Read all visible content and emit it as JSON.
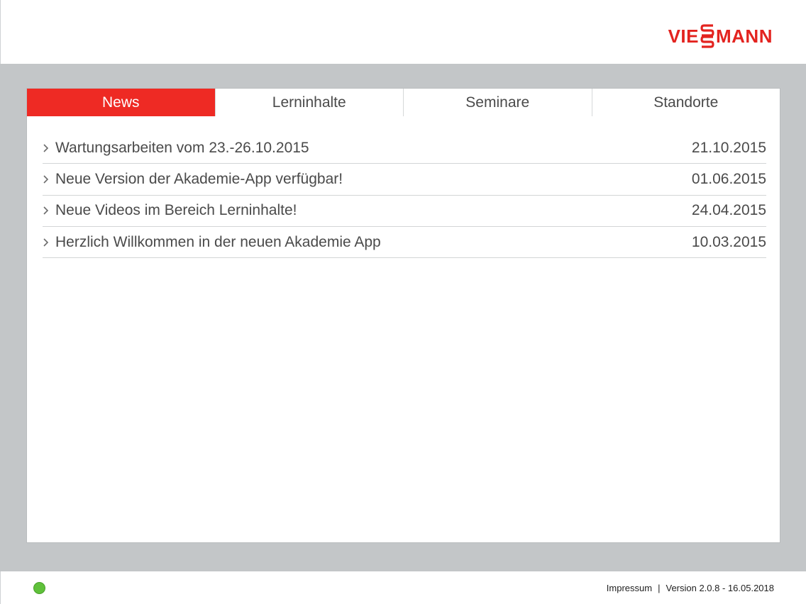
{
  "brand": {
    "logo_left": "VIE",
    "logo_right": "MANN",
    "color": "#e3231f"
  },
  "tabs": [
    {
      "label": "News",
      "active": true
    },
    {
      "label": "Lerninhalte",
      "active": false
    },
    {
      "label": "Seminare",
      "active": false
    },
    {
      "label": "Standorte",
      "active": false
    }
  ],
  "news": [
    {
      "title": "Wartungsarbeiten vom 23.-26.10.2015",
      "date": "21.10.2015"
    },
    {
      "title": "Neue Version der Akademie-App verfügbar!",
      "date": "01.06.2015"
    },
    {
      "title": "Neue Videos im Bereich Lerninhalte!",
      "date": "24.04.2015"
    },
    {
      "title": "Herzlich Willkommen in der neuen Akademie App",
      "date": "10.03.2015"
    }
  ],
  "footer": {
    "impressum": "Impressum",
    "separator": "|",
    "version": "Version 2.0.8 - 16.05.2018",
    "status_color": "#5fc13a"
  },
  "icons": {
    "chevron": "chevron-right-icon",
    "status": "status-dot-icon"
  },
  "colors": {
    "accent": "#ee2a24",
    "background": "#c3c6c8"
  }
}
